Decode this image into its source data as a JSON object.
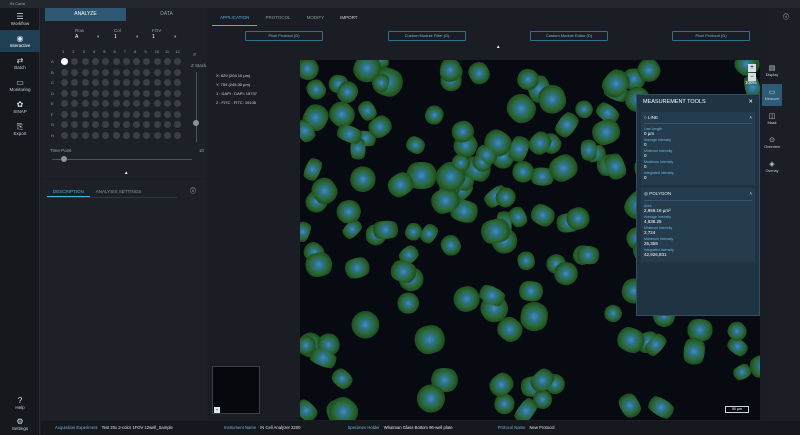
{
  "window": {
    "title": "IN Carta"
  },
  "leftnav": {
    "items": [
      {
        "label": "Workflow",
        "icon": "menu-icon"
      },
      {
        "label": "Interactive",
        "icon": "eye-icon"
      },
      {
        "label": "Batch",
        "icon": "batch-icon"
      },
      {
        "label": "Monitoring",
        "icon": "monitor-icon"
      },
      {
        "label": "SINAP",
        "icon": "sinap-icon"
      },
      {
        "label": "Export",
        "icon": "export-icon"
      }
    ],
    "bottom": [
      {
        "label": "Help",
        "icon": "help-icon"
      },
      {
        "label": "Settings",
        "icon": "gear-icon"
      }
    ]
  },
  "topTabs": {
    "analyze": "ANALYZE",
    "data": "DATA"
  },
  "selectors": {
    "well_label": "Row",
    "well_value": "A",
    "col_label": "Col",
    "col_value": "1",
    "fov_label": "FOV",
    "fov_value": "1"
  },
  "plate": {
    "cols": [
      "1",
      "2",
      "3",
      "4",
      "5",
      "6",
      "7",
      "8",
      "9",
      "10",
      "11",
      "12"
    ],
    "rows": [
      "A",
      "B",
      "C",
      "D",
      "E",
      "F",
      "G",
      "H"
    ],
    "z_label": "Z Stack",
    "time_label": "Time Point",
    "time_value": "10"
  },
  "descTabs": {
    "description": "DESCRIPTION",
    "analysis": "ANALYSIS SETTINGS"
  },
  "mainTabs": [
    "APPLICATION",
    "PROTOCOL",
    "MODIFY",
    "IMPORT"
  ],
  "protocolButtons": [
    "Pixel Protocol (D)",
    "Custom Module Filter (D)",
    "Custom Module Editor (D)",
    "Pixel Protocol (D)"
  ],
  "coords": {
    "x": "X: 629 (204.10 µm)",
    "y": "Y: 754 (245.30 µm)",
    "ch1": "1 : DAPI : DAPI: 15737",
    "ch2": "2 : FITC : FITC: 19105"
  },
  "zoom": "100%",
  "measurement": {
    "title": "MEASUREMENT TOOLS",
    "line": {
      "title": "LINE",
      "fields": [
        {
          "label": "Line Length",
          "value": "0 µm"
        },
        {
          "label": "Average Intensity",
          "value": "0"
        },
        {
          "label": "Minimum Intensity",
          "value": "0"
        },
        {
          "label": "Maximum Intensity",
          "value": "0"
        },
        {
          "label": "Integrated Intensity",
          "value": "0"
        }
      ]
    },
    "polygon": {
      "title": "POLYGON",
      "fields": [
        {
          "label": "Area",
          "value": "2,959.18 µm²"
        },
        {
          "label": "Average Intensity",
          "value": "4,638.25"
        },
        {
          "label": "Minimum Intensity",
          "value": "2,724"
        },
        {
          "label": "Maximum Intensity",
          "value": "25,359"
        },
        {
          "label": "Integrated Intensity",
          "value": "42,926,831"
        }
      ]
    }
  },
  "rightbar": [
    {
      "label": "Display",
      "icon": "display-icon"
    },
    {
      "label": "Measure",
      "icon": "measure-icon"
    },
    {
      "label": "Mask",
      "icon": "mask-icon"
    },
    {
      "label": "Overview",
      "icon": "overview-icon"
    },
    {
      "label": "Overlay",
      "icon": "overlay-icon"
    }
  ],
  "scalebar": "50 µm",
  "footer": {
    "acq_label": "Acquisition Experiment",
    "acq_value": "Test 20x 2-color 1FOV 12well_Sample",
    "inst_label": "Instrument Name",
    "inst_value": "IN Cell Analyzer 2200",
    "spec_label": "Specimen Holder",
    "spec_value": "Whatman Glass Bottom 96-well plate",
    "prot_label": "Protocol Name",
    "prot_value": "New Protocol"
  }
}
